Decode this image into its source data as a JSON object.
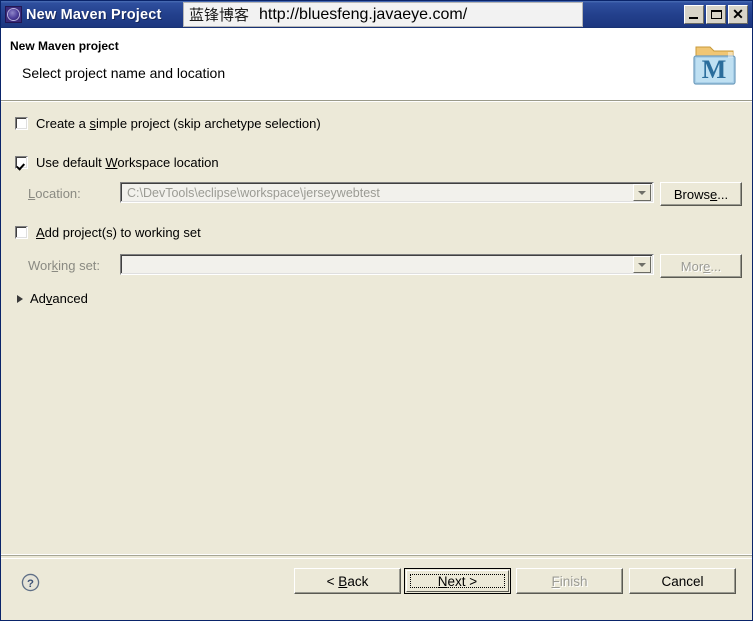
{
  "window": {
    "title": "New Maven Project",
    "icon": "maven-wizard-icon",
    "watermark_cn": "蓝锋博客",
    "watermark_url": "http://bluesfeng.javaeye.com/",
    "buttons": {
      "minimize": "_",
      "maximize": "□",
      "close": "✕"
    },
    "titlebar_color": "#23408c"
  },
  "header": {
    "title": "New Maven project",
    "subtitle": "Select project name and location",
    "icon": "maven-project-icon",
    "background": "#ffffff"
  },
  "form": {
    "simple_project": {
      "label_pre": "Create a ",
      "label_mnemonic": "s",
      "label_post": "imple project (skip archetype selection)",
      "checked": false
    },
    "default_workspace": {
      "label_pre": "Use default ",
      "label_mnemonic": "W",
      "label_post": "orkspace location",
      "checked": true
    },
    "location": {
      "label_mnemonic": "L",
      "label_pre": "",
      "label_post": "ocation:",
      "value": "C:\\DevTools\\eclipse\\workspace\\jerseywebtest",
      "disabled": true,
      "browse_pre": "Brows",
      "browse_mnemonic": "e",
      "browse_post": "..."
    },
    "working_set_checkbox": {
      "label_pre": "",
      "label_mnemonic": "A",
      "label_post": "dd project(s) to working set",
      "checked": false
    },
    "working_set": {
      "label_pre": "Wor",
      "label_mnemonic": "k",
      "label_post": "ing set:",
      "value": "",
      "disabled": true,
      "more_pre": "Mor",
      "more_mnemonic": "e",
      "more_post": "..."
    },
    "advanced": {
      "label_pre": "Ad",
      "label_mnemonic": "v",
      "label_post": "anced",
      "expanded": false
    }
  },
  "footer": {
    "help": "help-icon",
    "back": {
      "pre": "< ",
      "mnemonic": "B",
      "post": "ack",
      "disabled": false
    },
    "next": {
      "pre": "",
      "mnemonic": "N",
      "post": "ext >",
      "disabled": false,
      "is_default": true
    },
    "finish": {
      "pre": "",
      "mnemonic": "F",
      "post": "inish",
      "disabled": true
    },
    "cancel": {
      "pre": "Cancel",
      "mnemonic": "",
      "post": "",
      "disabled": false
    }
  },
  "colors": {
    "dialog_background": "#ece9d8",
    "title_active": "#23408c",
    "disabled_text": "#9b9b94"
  }
}
